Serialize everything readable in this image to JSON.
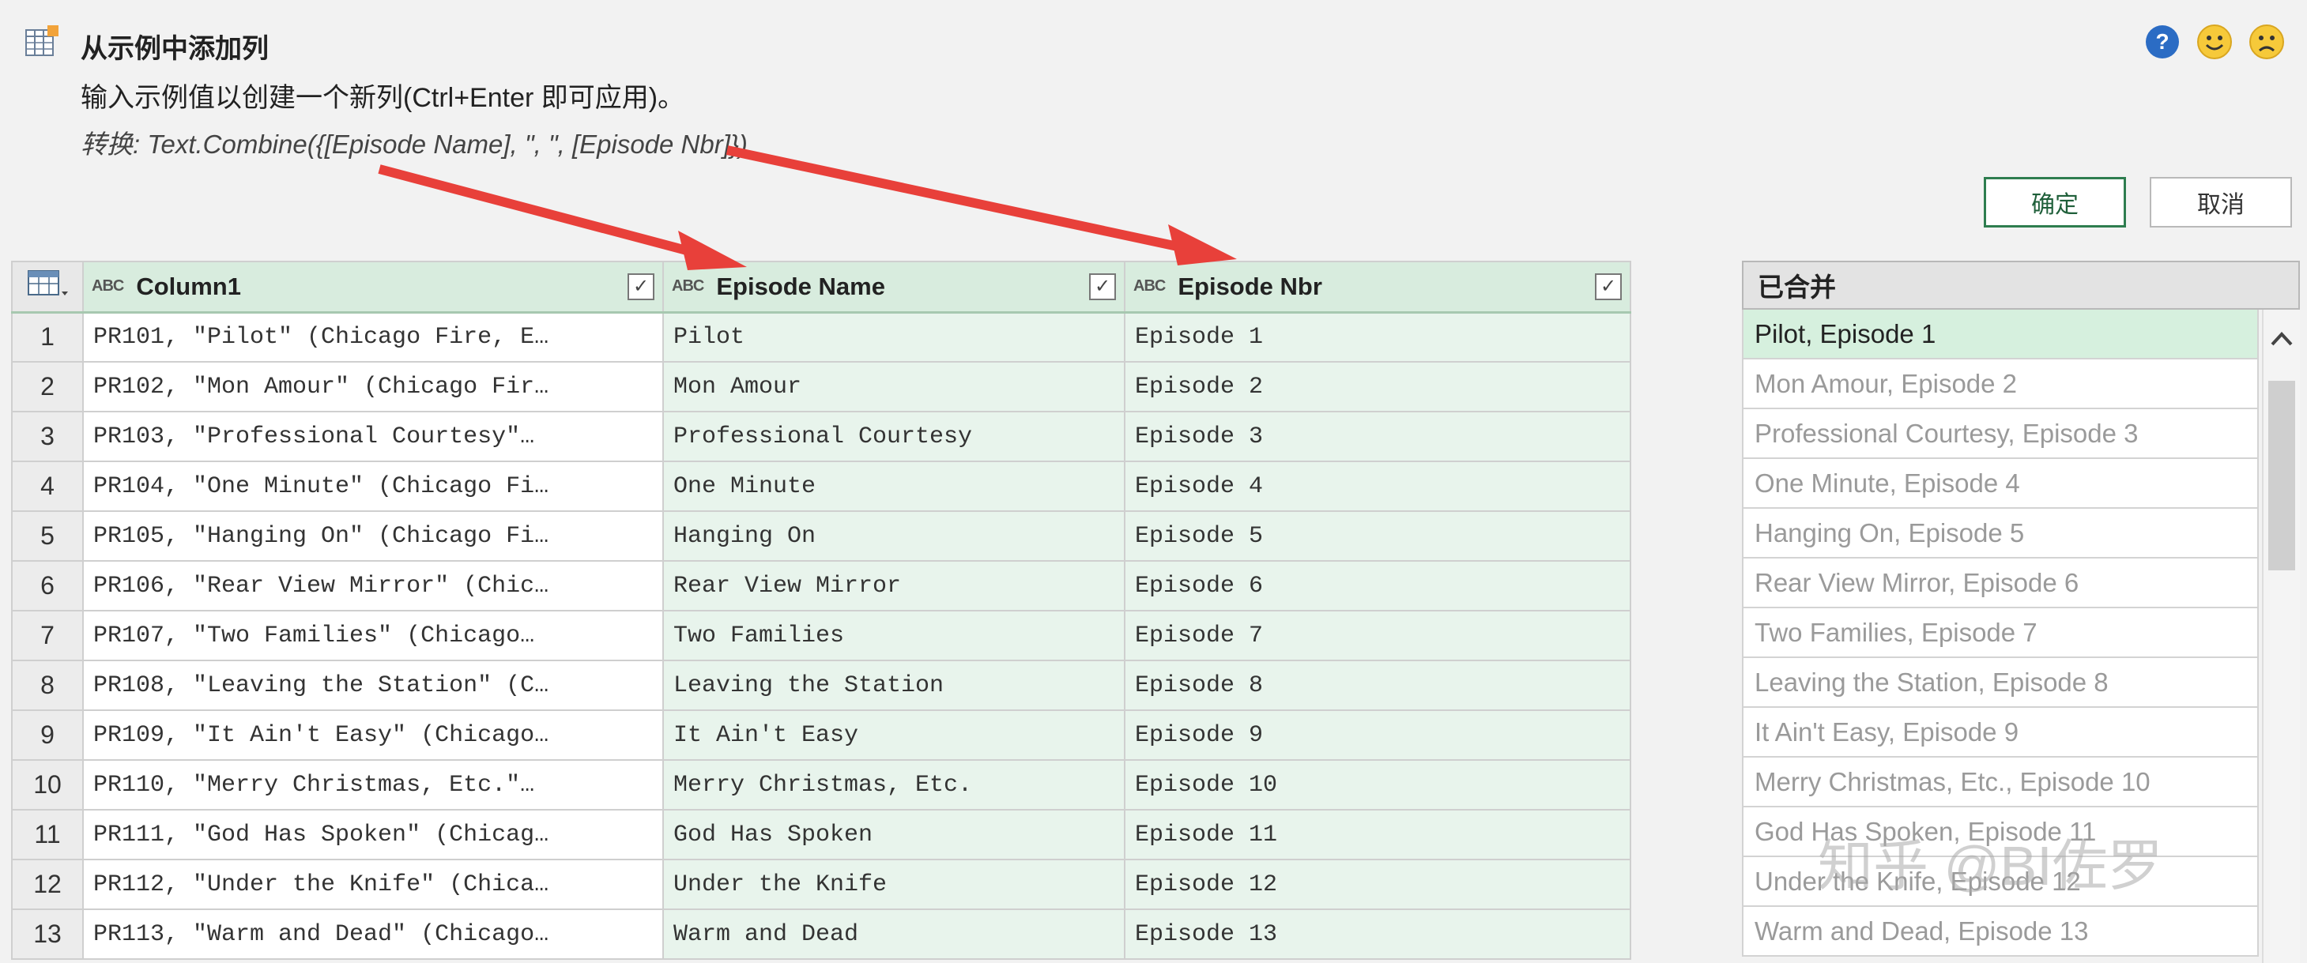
{
  "header": {
    "title": "从示例中添加列",
    "description": "输入示例值以创建一个新列(Ctrl+Enter 即可应用)。",
    "formula_label": "转换",
    "formula_text": ": Text.Combine({[Episode Name], \", \", [Episode Nbr]})"
  },
  "icons": {
    "header": "table-add-column-icon",
    "help": "help-icon",
    "smile": "smile-icon",
    "frown": "frown-icon"
  },
  "buttons": {
    "ok": "确定",
    "cancel": "取消"
  },
  "columns": [
    {
      "type_icon": "ABC",
      "label": "Column1",
      "checked": true
    },
    {
      "type_icon": "ABC",
      "label": "Episode Name",
      "checked": true
    },
    {
      "type_icon": "ABC",
      "label": "Episode Nbr",
      "checked": true
    }
  ],
  "rows": [
    {
      "n": "1",
      "c1": "PR101, \"Pilot\" (Chicago Fire, E…",
      "c2": "Pilot",
      "c3": "Episode 1"
    },
    {
      "n": "2",
      "c1": "PR102, \"Mon Amour\" (Chicago Fir…",
      "c2": "Mon Amour",
      "c3": "Episode 2"
    },
    {
      "n": "3",
      "c1": "PR103, \"Professional Courtesy\"…",
      "c2": "Professional Courtesy",
      "c3": "Episode 3"
    },
    {
      "n": "4",
      "c1": "PR104, \"One Minute\" (Chicago Fi…",
      "c2": "One Minute",
      "c3": "Episode 4"
    },
    {
      "n": "5",
      "c1": "PR105, \"Hanging On\" (Chicago Fi…",
      "c2": "Hanging On",
      "c3": "Episode 5"
    },
    {
      "n": "6",
      "c1": "PR106, \"Rear View Mirror\" (Chic…",
      "c2": "Rear View Mirror",
      "c3": "Episode 6"
    },
    {
      "n": "7",
      "c1": "PR107, \"Two Families\" (Chicago…",
      "c2": "Two Families",
      "c3": "Episode 7"
    },
    {
      "n": "8",
      "c1": "PR108, \"Leaving the Station\" (C…",
      "c2": "Leaving the Station",
      "c3": "Episode 8"
    },
    {
      "n": "9",
      "c1": "PR109, \"It Ain't Easy\" (Chicago…",
      "c2": "It Ain't Easy",
      "c3": "Episode 9"
    },
    {
      "n": "10",
      "c1": "PR110, \"Merry Christmas, Etc.\"…",
      "c2": "Merry Christmas, Etc.",
      "c3": "Episode 10"
    },
    {
      "n": "11",
      "c1": "PR111, \"God Has Spoken\" (Chicag…",
      "c2": "God Has Spoken",
      "c3": "Episode 11"
    },
    {
      "n": "12",
      "c1": "PR112, \"Under the Knife\" (Chica…",
      "c2": "Under the Knife",
      "c3": "Episode 12"
    },
    {
      "n": "13",
      "c1": "PR113, \"Warm and Dead\" (Chicago…",
      "c2": "Warm and Dead",
      "c3": "Episode 13"
    }
  ],
  "merged": {
    "header": "已合并",
    "items": [
      "Pilot, Episode 1",
      "Mon Amour, Episode 2",
      "Professional Courtesy, Episode 3",
      "One Minute, Episode 4",
      "Hanging On, Episode 5",
      "Rear View Mirror, Episode 6",
      "Two Families, Episode 7",
      "Leaving the Station, Episode 8",
      "It Ain't Easy, Episode 9",
      "Merry Christmas, Etc., Episode 10",
      "God Has Spoken, Episode 11",
      "Under the Knife, Episode 12",
      "Warm and Dead, Episode 13"
    ]
  },
  "watermark": "知乎 @BI佐罗",
  "colors": {
    "arrow": "#e8403a",
    "accent": "#2e7d4f",
    "selected_row": "#d6f0de"
  }
}
